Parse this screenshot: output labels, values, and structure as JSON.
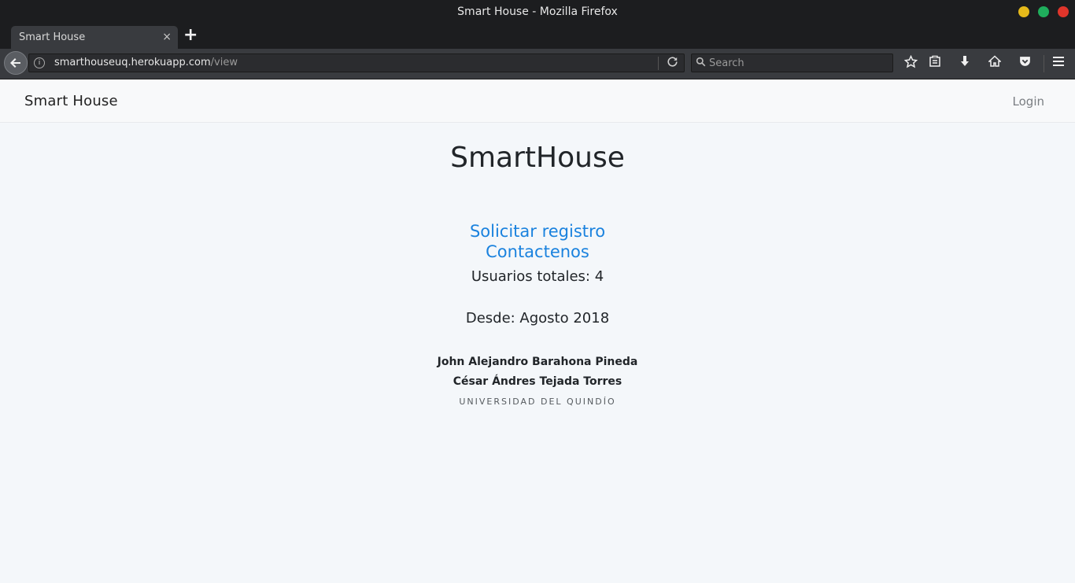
{
  "window": {
    "title": "Smart House - Mozilla Firefox",
    "controls": {
      "minimize_color": "#e5b91a",
      "maximize_color": "#1fae5c",
      "close_color": "#e0352b"
    }
  },
  "tab": {
    "title": "Smart House",
    "close_glyph": "×",
    "new_tab_glyph": "+"
  },
  "address_bar": {
    "host": "smarthouseuq.herokuapp.com",
    "path": "/view"
  },
  "search_bar": {
    "placeholder": "Search"
  },
  "toolbar_icons": [
    "star-icon",
    "library-icon",
    "download-icon",
    "home-icon",
    "pocket-icon",
    "menu-icon"
  ],
  "site_nav": {
    "brand": "Smart House",
    "login": "Login"
  },
  "main": {
    "title": "SmartHouse",
    "register_link": "Solicitar registro",
    "contact_link": "Contactenos",
    "total_users": "Usuarios totales: 4",
    "since": "Desde: Agosto 2018",
    "authors": [
      "John Alejandro Barahona Pineda",
      "César Ándres Tejada Torres"
    ],
    "university": "UNIVERSIDAD DEL QUINDÍO"
  },
  "colors": {
    "link": "#1a82de",
    "page_bg": "#f4f7fa",
    "nav_bg": "#f8f9fa"
  }
}
